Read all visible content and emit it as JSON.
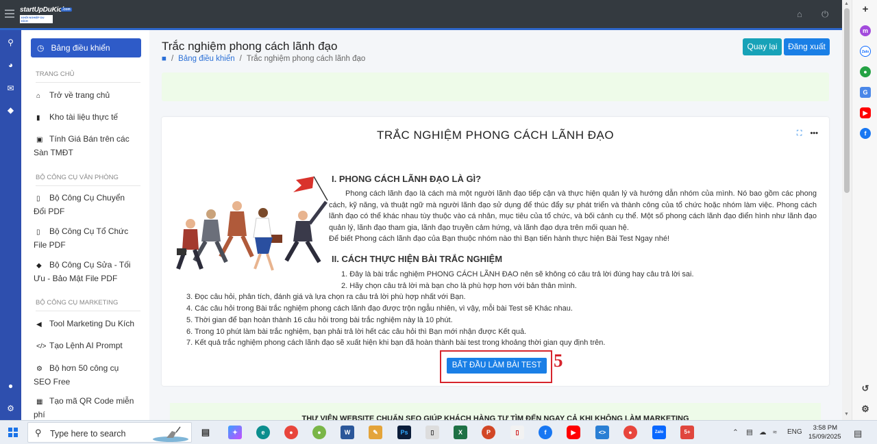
{
  "app": {
    "logo_brand": "startUpDuKich",
    "logo_badge": ".com",
    "logo_tagline": "KHỞI NGHIỆP DU KÍCH"
  },
  "sidebar": {
    "active_label": "Bảng điều khiển",
    "section_home": "TRANG CHỦ",
    "home_items": [
      "Trở về trang chủ",
      "Kho tài liệu thực tế",
      "Tính Giá Bán trên các Sàn TMĐT"
    ],
    "section_office": "BỘ CÔNG CỤ VĂN PHÒNG",
    "office_items": [
      "Bộ Công Cụ Chuyển Đổi PDF",
      "Bộ Công Cụ Tổ Chức File PDF",
      "Bộ Công Cụ Sửa - Tối Ưu - Bảo Mật File PDF"
    ],
    "section_marketing": "BỘ CÔNG CỤ MARKETING",
    "marketing_items": [
      "Tool Marketing Du Kích",
      "Tạo Lệnh AI Prompt",
      "Bộ hơn 50 công cụ SEO Free",
      "Tạo mã QR Code miễn phí"
    ]
  },
  "header": {
    "title": "Trắc nghiệm phong cách lãnh đạo",
    "breadcrumb_home": "Bảng điều khiển",
    "breadcrumb_current": "Trắc nghiệm phong cách lãnh đạo",
    "back_button": "Quay lại",
    "logout_button": "Đăng xuất"
  },
  "card": {
    "title": "TRẮC NGHIỆM PHONG CÁCH LÃNH ĐẠO",
    "section1_heading": "I. PHONG CÁCH LÃNH ĐẠO LÀ GÌ?",
    "section1_text": "Phong cách lãnh đạo là cách mà một người lãnh đạo tiếp cận và thực hiện quản lý và hướng dẫn nhóm của mình. Nó bao gồm các phong cách, kỹ năng, và thuật ngữ mà người lãnh đạo sử dụng để thúc đẩy sự phát triển và thành công của tổ chức hoặc nhóm làm việc. Phong cách lãnh đạo có thể khác nhau tùy thuộc vào cá nhân, mục tiêu của tổ chức, và bối cảnh cụ thể. Một số phong cách lãnh đạo điển hình như lãnh đạo quản lý, lãnh đạo tham gia, lãnh đạo truyền cảm hứng, và lãnh đạo dựa trên mối quan hệ.",
    "section1_note": "Để biết Phong cách lãnh đạo của Bạn thuộc nhóm nào thì Bạn tiến hành thực hiện Bài Test Ngay nhé!",
    "section2_heading": "II. CÁCH THỰC HIỆN BÀI TRẮC NGHIỆM",
    "steps": [
      "1. Đây là bài trắc nghiệm PHONG CÁCH LÃNH ĐẠO nên sẽ không có câu trả lời đúng hay câu trả lời sai.",
      "2. Hãy chọn câu trả lời mà bạn cho là phù hợp hơn với bản thân mình.",
      "3. Đọc câu hỏi, phân tích, đánh giá và lựa chọn ra câu trả lời phù hợp nhất với Bạn.",
      "4. Các câu hỏi trong Bài trắc nghiệm phong cách lãnh đạo được trộn ngẫu nhiên, vì vậy, mỗi bài Test sẽ Khác nhau.",
      "5. Thời gian để bạn hoàn thành 16 câu hỏi trong bài trắc nghiệm này là 10 phút.",
      "6. Trong 10 phút làm bài trắc nghiệm, bạn phải trả lời hết các câu hỏi thì Bạn mới nhận được Kết quả.",
      "7. Kết quả trắc nghiệm phong cách lãnh đạo sẽ xuất hiện khi bạn đã hoàn thành bài test trong khoảng thời gian quy định trên."
    ],
    "start_button": "BẮT ĐẦU LÀM BÀI TEST",
    "step_marker": "5"
  },
  "footer_panel": {
    "text": "THƯ VIỆN WEBSITE CHUẨN SEO GIÚP KHÁCH HÀNG TỰ TÌM ĐẾN NGAY CẢ KHI KHÔNG LÀM MARKETING"
  },
  "taskbar": {
    "search_placeholder": "Type here to search",
    "lang": "ENG",
    "time": "3:58 PM",
    "date": "15/09/2025"
  }
}
